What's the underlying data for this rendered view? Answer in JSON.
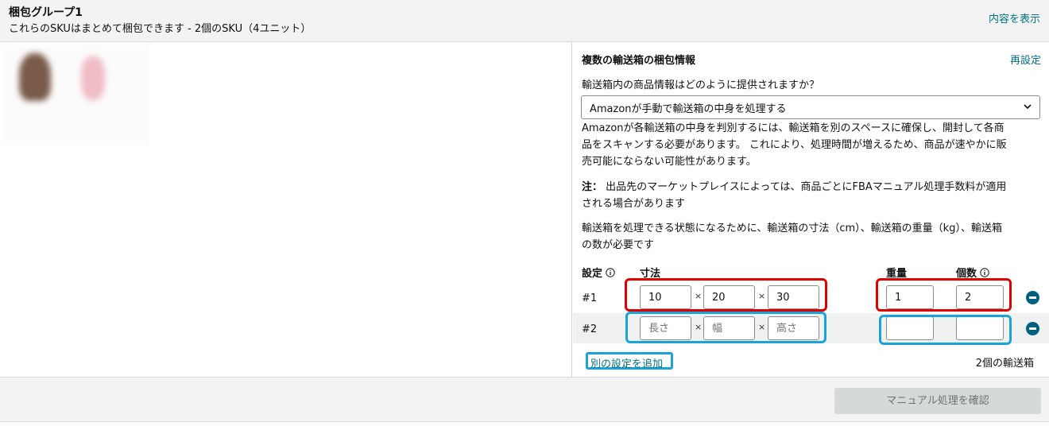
{
  "header": {
    "title": "梱包グループ1",
    "subtitle": "これらのSKUはまとめて梱包できます - 2個のSKU（4ユニット）",
    "show_link": "内容を表示"
  },
  "boxes": {
    "section_title": "複数の輸送箱の梱包情報",
    "reset_link": "再設定",
    "question": "輸送箱内の商品情報はどのように提供されますか？",
    "select_value": "Amazonが手動で輸送箱の中身を処理する",
    "description_line1": "Amazonが各輸送箱の中身を判別するには、輸送箱を別のスペースに確保し、開封して各商",
    "description_line2": "品をスキャンする必要があります。 これにより、処理時間が増えるため、商品が速やかに販",
    "description_line3": "売可能にならない可能性があります。",
    "note_label": "注：",
    "note_line1": "出品先のマーケットプレイスによっては、商品ごとにFBAマニュアル処理手数料が適用",
    "note_line2": "される場合があります",
    "requirement_line1": "輸送箱を処理できる状態になるために、輸送箱の寸法（cm）、輸送箱の重量（kg）、輸送箱",
    "requirement_line2": "の数が必要です",
    "columns": {
      "config": "設定",
      "dimensions": "寸法",
      "weight": "重量",
      "count": "個数"
    },
    "multiply_sign": "×",
    "rows": [
      {
        "label": "#1",
        "length": "10",
        "width": "20",
        "height": "30",
        "weight": "1",
        "count": "2"
      },
      {
        "label": "#2",
        "length": "",
        "width": "",
        "height": "",
        "weight": "",
        "count": ""
      }
    ],
    "placeholders": {
      "length": "長さ",
      "width": "幅",
      "height": "高さ"
    },
    "add_link": "別の設定を追加",
    "box_count": "2個の輸送箱"
  },
  "footer": {
    "confirm_button": "マニュアル処理を確認"
  },
  "colors": {
    "link": "#007185",
    "highlight_red": "#e00000",
    "highlight_blue": "#1aa3d9",
    "remove_button": "#00617f"
  }
}
